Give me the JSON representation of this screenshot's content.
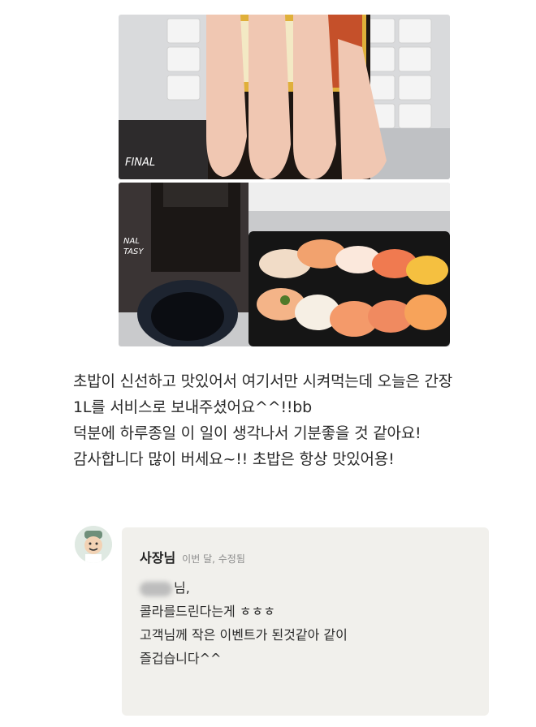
{
  "photos": [
    {
      "label": "FINAL",
      "description_icon": "soy-sauce-bottle-hand-photo"
    },
    {
      "label1": "NAL",
      "label2": "TASY",
      "description_icon": "sushi-box-photo"
    }
  ],
  "review": {
    "lines": [
      "초밥이 신선하고 맛있어서 여기서만 시켜먹는데 오늘은 간장",
      "1L를 서비스로 보내주셨어요^^!!bb",
      "덕분에 하루종일 이 일이 생각나서 기분좋을 것 같아요!",
      "감사합니다 많이 버세요~!! 초밥은 항상 맛있어용!"
    ]
  },
  "reply": {
    "owner": "사장님",
    "meta": "이번 달, 수정됨",
    "greeting_suffix": "님,",
    "lines": [
      "콜라를드린다는게 ㅎㅎㅎ",
      "고객님께 작은 이벤트가 된것같아 같이",
      "즐겁습니다^^"
    ]
  },
  "colors": {
    "bubble": "#f1f0ec",
    "text": "#2a2a2a",
    "meta": "#8a8a8a"
  }
}
